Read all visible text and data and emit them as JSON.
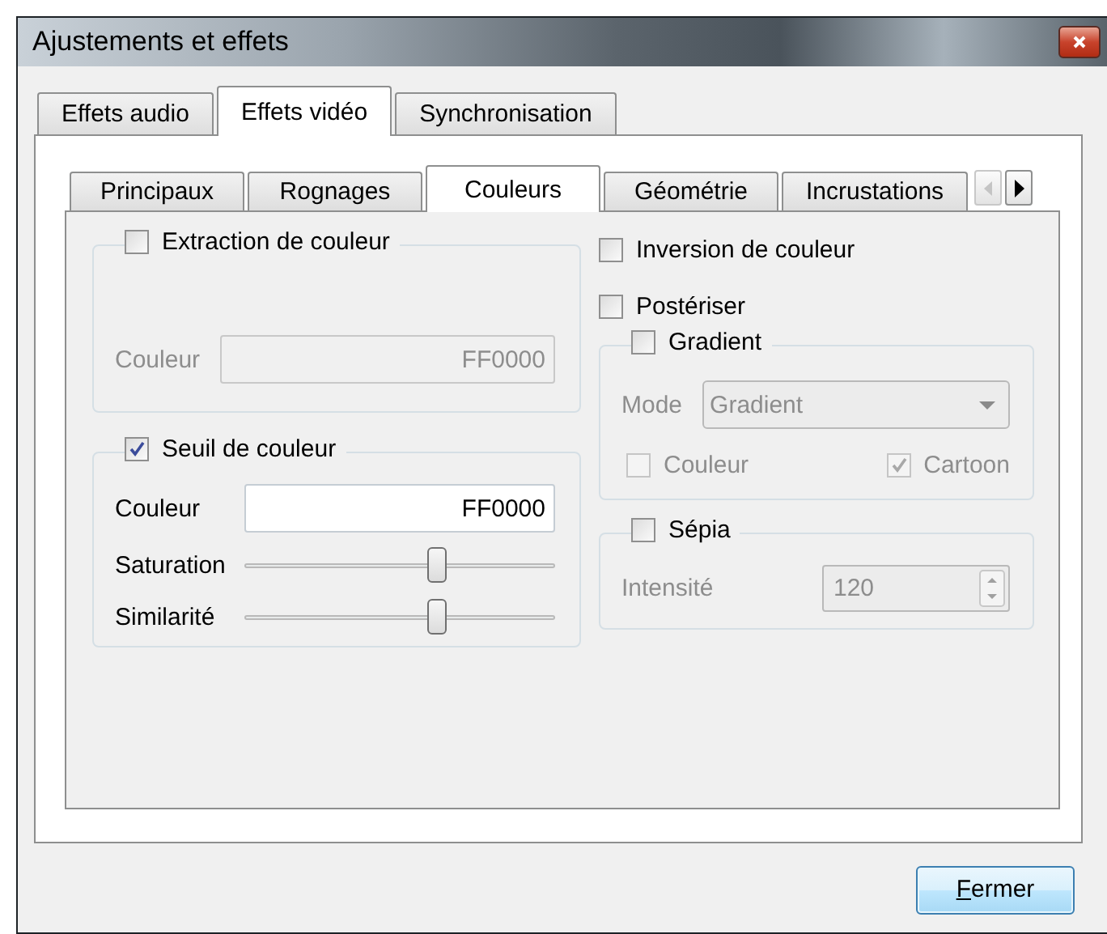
{
  "window": {
    "title": "Ajustements et effets"
  },
  "tabs": [
    {
      "label": "Effets audio",
      "selected": false
    },
    {
      "label": "Effets vidéo",
      "selected": true
    },
    {
      "label": "Synchronisation",
      "selected": false
    }
  ],
  "subtabs": [
    {
      "label": "Principaux",
      "selected": false
    },
    {
      "label": "Rognages",
      "selected": false
    },
    {
      "label": "Couleurs",
      "selected": true
    },
    {
      "label": "Géométrie",
      "selected": false
    },
    {
      "label": "Incrustations",
      "selected": false
    }
  ],
  "extraction": {
    "label": "Extraction de couleur",
    "checked": false,
    "color_label": "Couleur",
    "color_value": "FF0000"
  },
  "threshold": {
    "label": "Seuil de couleur",
    "checked": true,
    "color_label": "Couleur",
    "color_value": "FF0000",
    "sliders": [
      {
        "label": "Saturation",
        "level": 0.62
      },
      {
        "label": "Similarité",
        "level": 0.62
      }
    ]
  },
  "invert": {
    "label": "Inversion de couleur",
    "checked": false
  },
  "posterize": {
    "label": "Postériser",
    "checked": false
  },
  "gradient": {
    "label": "Gradient",
    "checked": false,
    "mode_label": "Mode",
    "mode_value": "Gradient",
    "options": [
      {
        "label": "Couleur",
        "checked": false
      },
      {
        "label": "Cartoon",
        "checked": true
      }
    ]
  },
  "sepia": {
    "label": "Sépia",
    "checked": false,
    "intensity_label": "Intensité",
    "intensity_value": "120"
  },
  "close_button": "Fermer"
}
